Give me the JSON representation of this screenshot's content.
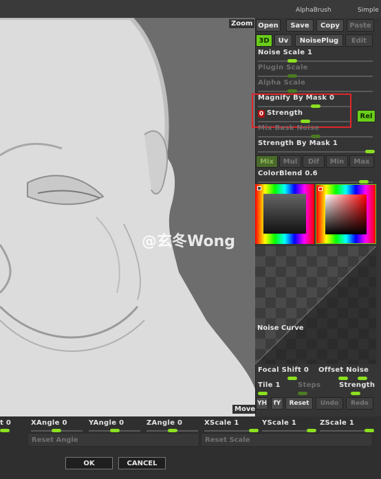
{
  "topbar": {
    "alpha_brush": "AlphaBrush",
    "simple": "Simple"
  },
  "viewport": {
    "zoom": "Zoom",
    "move": "Move",
    "watermark": "@玄冬Wong"
  },
  "panel": {
    "buttons": {
      "open": "Open",
      "save": "Save",
      "copy": "Copy",
      "paste": "Paste",
      "d3": "3D",
      "uv": "Uv",
      "noiseplug": "NoisePlug",
      "edit": "Edit",
      "rel": "Rel"
    },
    "noise_scale": "Noise Scale 1",
    "plugin_scale": "Plugin Scale",
    "alpha_scale": "Alpha Scale",
    "magnify_by_mask": "Magnify By Mask 0",
    "strength_zero": "0",
    "strength": "Strength",
    "mix_bask_noise": "Mix Bask Noise",
    "strength_by_mask": "Strength By Mask 1",
    "mix_buttons": [
      "Mix",
      "Mul",
      "Dif",
      "Min",
      "Max"
    ],
    "colorblend": "ColorBlend 0.6",
    "noise_curve": "Noise Curve",
    "focal_shift": "Focal Shift 0",
    "offset_noise": "Offset Noise",
    "tile": "Tile 1",
    "steps": "Steps",
    "strength2": "Strength",
    "bottom_buttons": [
      "YH",
      "fY",
      "Reset",
      "Undo",
      "Redo"
    ]
  },
  "bottom": {
    "t_value": "t 0",
    "xangle": "XAngle 0",
    "yangle": "YAngle 0",
    "zangle": "ZAngle 0",
    "xscale": "XScale 1",
    "yscale": "YScale 1",
    "zscale": "ZScale 1",
    "reset_angle": "Reset Angle",
    "reset_scale": "Reset Scale",
    "ok": "OK",
    "cancel": "CANCEL"
  }
}
